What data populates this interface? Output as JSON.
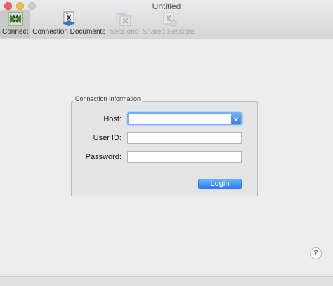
{
  "window": {
    "title": "Untitled"
  },
  "toolbar": {
    "items": [
      {
        "label": "Connect",
        "icon": "connect-icon",
        "state": "selected"
      },
      {
        "label": "Connection Documents",
        "icon": "connection-documents-icon",
        "state": "enabled"
      },
      {
        "label": "Sessions",
        "icon": "sessions-icon",
        "state": "disabled"
      },
      {
        "label": "Shared Sessions",
        "icon": "shared-sessions-icon",
        "state": "disabled"
      }
    ]
  },
  "connection": {
    "legend": "Connection Information",
    "host_label": "Host:",
    "host_value": "",
    "user_label": "User ID:",
    "user_value": "",
    "password_label": "Password:",
    "password_value": "",
    "login_label": "Login"
  },
  "help": {
    "label": "?"
  },
  "colors": {
    "accent": "#2d7cf0",
    "focus_ring": "#7aaef0",
    "close": "#fc605c",
    "minimize": "#fdbc40"
  }
}
